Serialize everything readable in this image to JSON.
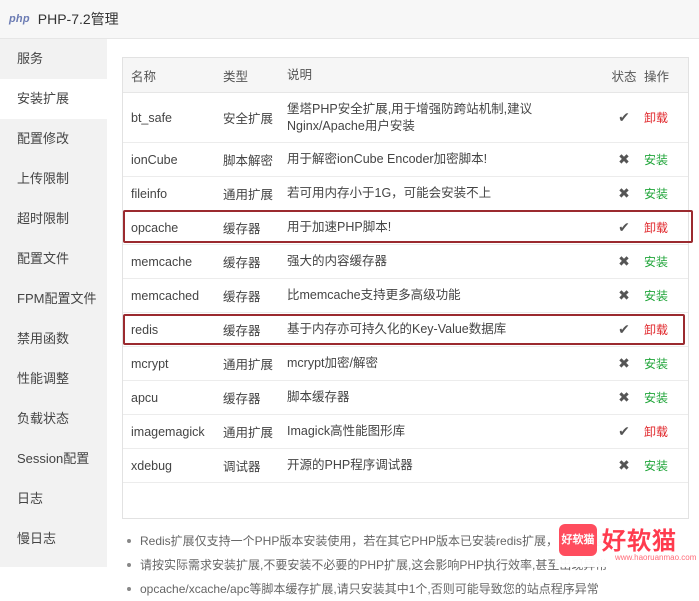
{
  "window": {
    "logo": "php",
    "title": "PHP-7.2管理"
  },
  "sidebar": {
    "items": [
      {
        "label": "服务"
      },
      {
        "label": "安装扩展"
      },
      {
        "label": "配置修改"
      },
      {
        "label": "上传限制"
      },
      {
        "label": "超时限制"
      },
      {
        "label": "配置文件"
      },
      {
        "label": "FPM配置文件"
      },
      {
        "label": "禁用函数"
      },
      {
        "label": "性能调整"
      },
      {
        "label": "负载状态"
      },
      {
        "label": "Session配置"
      },
      {
        "label": "日志"
      },
      {
        "label": "慢日志"
      }
    ],
    "active": "安装扩展"
  },
  "table": {
    "headers": {
      "name": "名称",
      "type": "类型",
      "desc": "说明",
      "status": "状态",
      "op": "操作"
    },
    "rows": [
      {
        "name": "bt_safe",
        "type": "安全扩展",
        "desc": "堡塔PHP安全扩展,用于增强防跨站机制,建议Nginx/Apache用户安装",
        "status": "✔",
        "op": "卸载"
      },
      {
        "name": "ionCube",
        "type": "脚本解密",
        "desc": "用于解密ionCube Encoder加密脚本!",
        "status": "✖",
        "op": "安装"
      },
      {
        "name": "fileinfo",
        "type": "通用扩展",
        "desc": "若可用内存小于1G，可能会安装不上",
        "status": "✖",
        "op": "安装"
      },
      {
        "name": "opcache",
        "type": "缓存器",
        "desc": "用于加速PHP脚本!",
        "status": "✔",
        "op": "卸载"
      },
      {
        "name": "memcache",
        "type": "缓存器",
        "desc": "强大的内容缓存器",
        "status": "✖",
        "op": "安装"
      },
      {
        "name": "memcached",
        "type": "缓存器",
        "desc": "比memcache支持更多高级功能",
        "status": "✖",
        "op": "安装"
      },
      {
        "name": "redis",
        "type": "缓存器",
        "desc": "基于内存亦可持久化的Key-Value数据库",
        "status": "✔",
        "op": "卸载"
      },
      {
        "name": "mcrypt",
        "type": "通用扩展",
        "desc": "mcrypt加密/解密",
        "status": "✖",
        "op": "安装"
      },
      {
        "name": "apcu",
        "type": "缓存器",
        "desc": "脚本缓存器",
        "status": "✖",
        "op": "安装"
      },
      {
        "name": "imagemagick",
        "type": "通用扩展",
        "desc": "Imagick高性能图形库",
        "status": "✔",
        "op": "卸载"
      },
      {
        "name": "xdebug",
        "type": "调试器",
        "desc": "开源的PHP程序调试器",
        "status": "✖",
        "op": "安装"
      }
    ]
  },
  "notes": [
    "Redis扩展仅支持一个PHP版本安装使用，若在其它PHP版本已安装redis扩展，请勿再装",
    "请按实际需求安装扩展,不要安装不必要的PHP扩展,这会影响PHP执行效率,甚至出现异常",
    "opcache/xcache/apc等脚本缓存扩展,请只安装其中1个,否则可能导致您的站点程序异常"
  ],
  "watermark": {
    "badge": "好软猫",
    "text": "好软猫",
    "url": "www.haoruanmao.com"
  },
  "colors": {
    "install": "#20a53a",
    "uninstall": "#e0262a",
    "highlight": "#9b2a2f"
  }
}
